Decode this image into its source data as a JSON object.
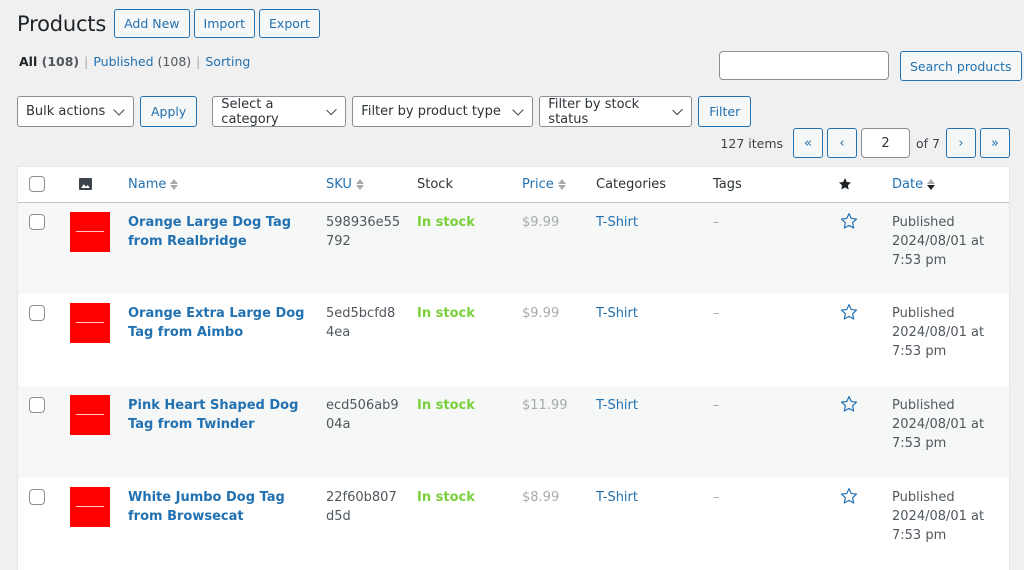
{
  "header": {
    "title": "Products",
    "buttons": {
      "add_new": "Add New",
      "import": "Import",
      "export": "Export"
    }
  },
  "views": [
    {
      "label": "All",
      "count": "(108)",
      "current": true
    },
    {
      "label": "Published",
      "count": "(108)",
      "current": false
    },
    {
      "label": "Sorting",
      "count": "",
      "current": false
    }
  ],
  "search": {
    "value": "",
    "placeholder": "",
    "button": "Search products"
  },
  "filters": {
    "bulk_actions": "Bulk actions",
    "apply": "Apply",
    "category": "Select a category",
    "product_type": "Filter by product type",
    "stock_status": "Filter by stock status",
    "filter": "Filter"
  },
  "pagination": {
    "items": "127 items",
    "first": "«",
    "prev": "‹",
    "current_page": "2",
    "of": "of 7",
    "next": "›",
    "last": "»"
  },
  "table": {
    "columns": {
      "thumb_icon": "image-icon",
      "name": "Name",
      "sku": "SKU",
      "stock": "Stock",
      "price": "Price",
      "categories": "Categories",
      "tags": "Tags",
      "featured_icon": "star-icon",
      "date": "Date"
    },
    "rows": [
      {
        "name": "Orange Large Dog Tag from Realbridge",
        "sku": "598936e55792",
        "stock": "In stock",
        "price": "$9.99",
        "category": "T-Shirt",
        "tags": "–",
        "date_status": "Published",
        "date": "2024/08/01 at 7:53 pm",
        "thumb_color": "#ff0000"
      },
      {
        "name": "Orange Extra Large Dog Tag from Aimbo",
        "sku": "5ed5bcfd84ea",
        "stock": "In stock",
        "price": "$9.99",
        "category": "T-Shirt",
        "tags": "–",
        "date_status": "Published",
        "date": "2024/08/01 at 7:53 pm",
        "thumb_color": "#ff0000"
      },
      {
        "name": "Pink Heart Shaped Dog Tag from Twinder",
        "sku": "ecd506ab904a",
        "stock": "In stock",
        "price": "$11.99",
        "category": "T-Shirt",
        "tags": "–",
        "date_status": "Published",
        "date": "2024/08/01 at 7:53 pm",
        "thumb_color": "#ff0000"
      },
      {
        "name": "White Jumbo Dog Tag from Browsecat",
        "sku": "22f60b807d5d",
        "stock": "In stock",
        "price": "$8.99",
        "category": "T-Shirt",
        "tags": "–",
        "date_status": "Published",
        "date": "2024/08/01 at 7:53 pm",
        "thumb_color": "#ff0000"
      }
    ]
  },
  "colors": {
    "link": "#2271b1",
    "in_stock": "#7ad03a",
    "background": "#f0f0f1"
  }
}
